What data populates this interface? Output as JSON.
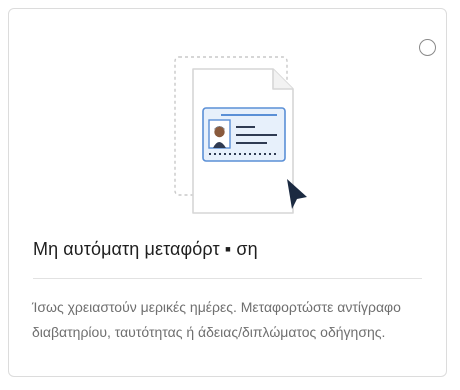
{
  "option_card": {
    "title": "Μη αυτόματη μεταφόρτ ▪ ση",
    "description": "Ίσως χρειαστούν μερικές ημέρες. Μεταφορτώστε αντίγραφο διαβατηρίου, ταυτότητας ή άδειας/διπλώματος οδήγησης.",
    "selected": false,
    "illustration_icon": "id-document-upload-icon",
    "colors": {
      "accent_dark": "#1b2a41",
      "card_blue": "#5a8fd6",
      "card_fill": "#e7f0fb",
      "border": "#dcdcdc"
    }
  }
}
